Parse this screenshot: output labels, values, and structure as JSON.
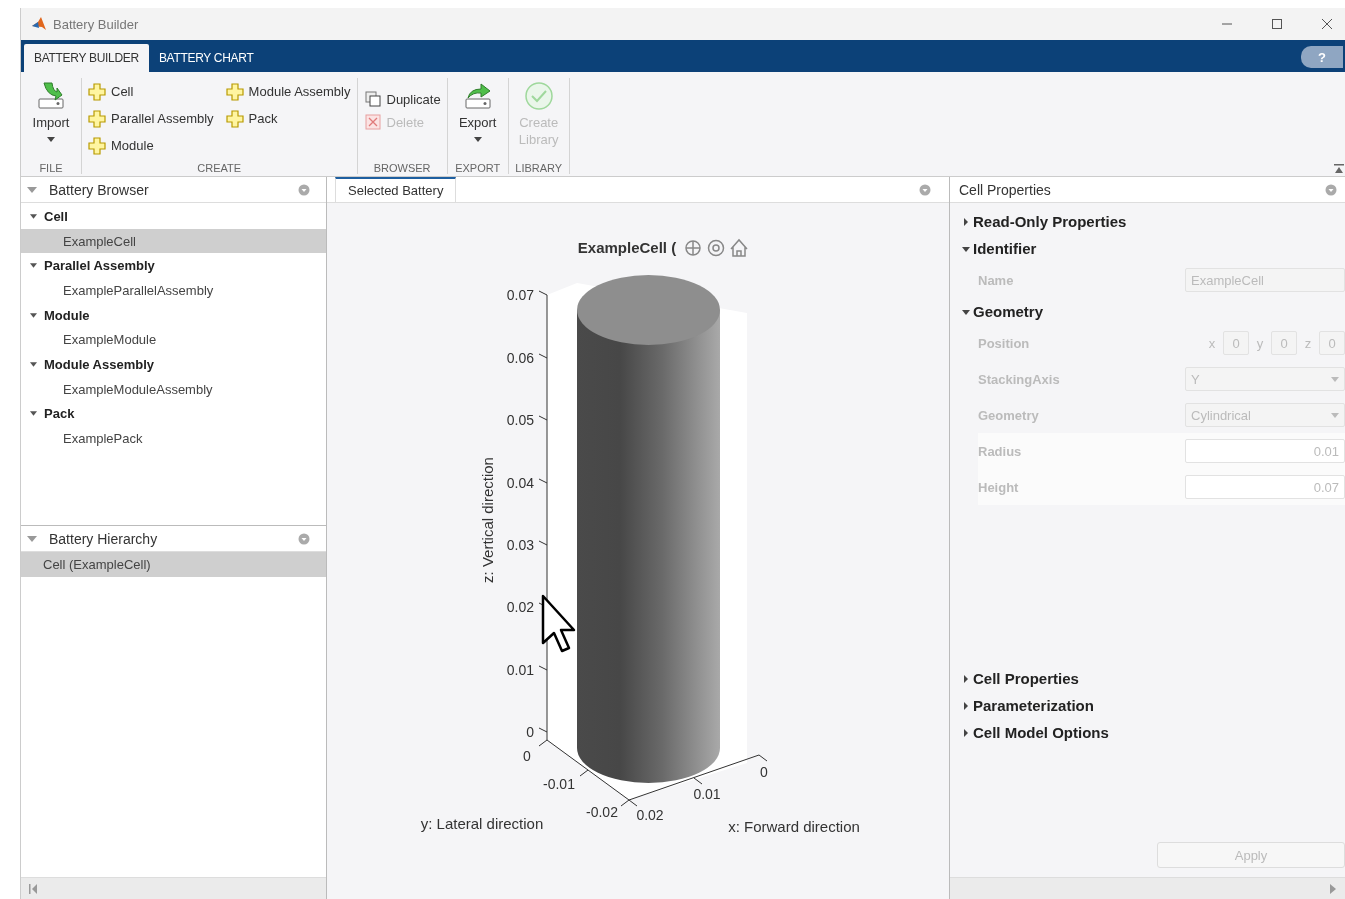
{
  "window": {
    "title": "Battery Builder",
    "help": "?"
  },
  "tabs": [
    {
      "label": "BATTERY BUILDER",
      "selected": true
    },
    {
      "label": "BATTERY CHART",
      "selected": false
    }
  ],
  "toolstrip": {
    "sections": [
      {
        "label": "FILE",
        "kind": "large",
        "buttons": [
          {
            "label": "Import",
            "kind": "import",
            "dropdown": true,
            "disabled": false
          }
        ]
      },
      {
        "label": "CREATE",
        "kind": "grid",
        "buttons": [
          {
            "label": "Cell",
            "kind": "add",
            "dropdown": false,
            "disabled": false
          },
          {
            "label": "Parallel Assembly",
            "kind": "add",
            "dropdown": false,
            "disabled": false
          },
          {
            "label": "Module",
            "kind": "add",
            "dropdown": false,
            "disabled": false
          },
          {
            "label": "Module Assembly",
            "kind": "add",
            "dropdown": false,
            "disabled": false
          },
          {
            "label": "Pack",
            "kind": "add",
            "dropdown": false,
            "disabled": false
          }
        ]
      },
      {
        "label": "BROWSER",
        "kind": "list",
        "buttons": [
          {
            "label": "Duplicate",
            "kind": "duplicate",
            "dropdown": false,
            "disabled": false
          },
          {
            "label": "Delete",
            "kind": "delete",
            "dropdown": false,
            "disabled": true
          }
        ]
      },
      {
        "label": "EXPORT",
        "kind": "large",
        "buttons": [
          {
            "label": "Export",
            "kind": "export",
            "dropdown": true,
            "disabled": false
          }
        ]
      },
      {
        "label": "LIBRARY",
        "kind": "large",
        "buttons": [
          {
            "label": "Create Library",
            "kind": "library",
            "dropdown": false,
            "disabled": true
          }
        ]
      }
    ]
  },
  "browser": {
    "title": "Battery Browser",
    "items": [
      {
        "label": "Cell",
        "expanded": true,
        "selected": false,
        "children": [
          {
            "label": "ExampleCell",
            "selected": true
          }
        ]
      },
      {
        "label": "Parallel Assembly",
        "expanded": true,
        "selected": false,
        "children": [
          {
            "label": "ExampleParallelAssembly",
            "selected": false
          }
        ]
      },
      {
        "label": "Module",
        "expanded": true,
        "selected": false,
        "children": [
          {
            "label": "ExampleModule",
            "selected": false
          }
        ]
      },
      {
        "label": "Module Assembly",
        "expanded": true,
        "selected": false,
        "children": [
          {
            "label": "ExampleModuleAssembly",
            "selected": false
          }
        ]
      },
      {
        "label": "Pack",
        "expanded": true,
        "selected": false,
        "children": [
          {
            "label": "ExamplePack",
            "selected": false
          }
        ]
      }
    ]
  },
  "hierarchy": {
    "title": "Battery Hierarchy",
    "items": [
      {
        "label": "Cell (ExampleCell)",
        "selected": true
      }
    ]
  },
  "document_tabs": [
    {
      "label": "Selected Battery",
      "selected": true
    }
  ],
  "plot": {
    "title": "ExampleCell (",
    "z_ticks": [
      "0.07",
      "0.06",
      "0.05",
      "0.04",
      "0.03",
      "0.02",
      "0.01",
      "0"
    ],
    "y_ticks": [
      "0",
      "-0.01",
      "-0.02"
    ],
    "x_ticks": [
      "0.02",
      "0.01",
      "0"
    ],
    "zlabel": "z: Vertical direction",
    "ylabel": "y: Lateral direction",
    "xlabel": "x: Forward direction"
  },
  "properties": {
    "title": "Cell Properties",
    "sections": [
      {
        "label": "Read-Only Properties",
        "expanded": false
      },
      {
        "label": "Identifier",
        "expanded": true,
        "rows": [
          {
            "label": "Name",
            "kind": "text",
            "value": "ExampleCell",
            "disabled": true
          }
        ]
      },
      {
        "label": "Geometry",
        "expanded": true,
        "rows": [
          {
            "label": "Position",
            "kind": "xyz",
            "disabled": true,
            "coords": [
              {
                "axis": "x",
                "value": "0"
              },
              {
                "axis": "y",
                "value": "0"
              },
              {
                "axis": "z",
                "value": "0"
              }
            ]
          },
          {
            "label": "StackingAxis",
            "kind": "dropdown",
            "value": "Y",
            "disabled": true
          },
          {
            "label": "Geometry",
            "kind": "dropdown",
            "value": "Cylindrical",
            "disabled": true
          },
          {
            "label": "Radius",
            "kind": "number",
            "value": "0.01",
            "disabled": false
          },
          {
            "label": "Height",
            "kind": "number",
            "value": "0.07",
            "disabled": false
          }
        ]
      },
      {
        "label": "Cell Properties",
        "expanded": false
      },
      {
        "label": "Parameterization",
        "expanded": false
      },
      {
        "label": "Cell Model Options",
        "expanded": false
      }
    ],
    "apply": {
      "label": "Apply",
      "disabled": true
    }
  }
}
